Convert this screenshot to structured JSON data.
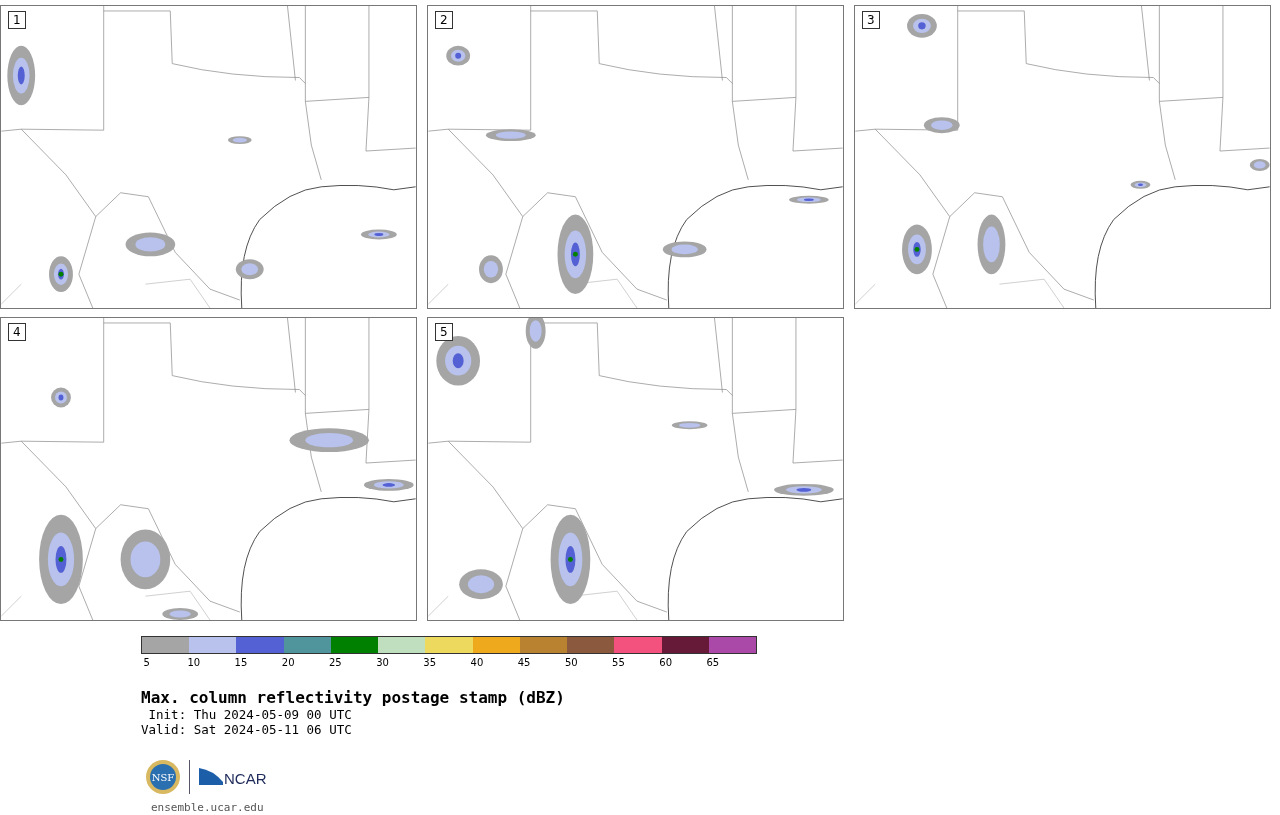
{
  "panels": [
    {
      "label": "1"
    },
    {
      "label": "2"
    },
    {
      "label": "3"
    },
    {
      "label": "4"
    },
    {
      "label": "5"
    }
  ],
  "colorbar": {
    "bins": [
      {
        "color": "#a5a5a5"
      },
      {
        "color": "#b8c2ec"
      },
      {
        "color": "#5461d4"
      },
      {
        "color": "#4f959b"
      },
      {
        "color": "#008000"
      },
      {
        "color": "#bfdfbf"
      },
      {
        "color": "#eed95f"
      },
      {
        "color": "#eeaa1c"
      },
      {
        "color": "#b88230"
      },
      {
        "color": "#8b5a3e"
      },
      {
        "color": "#f3527f"
      },
      {
        "color": "#661a38"
      },
      {
        "color": "#aa49a7"
      }
    ],
    "ticks": [
      "5",
      "10",
      "15",
      "20",
      "25",
      "30",
      "35",
      "40",
      "45",
      "50",
      "55",
      "60",
      "65"
    ]
  },
  "title": "Max. column reflectivity postage stamp (dBZ)",
  "init": " Init: Thu 2024-05-09 00 UTC",
  "valid": "Valid: Sat 2024-05-11 06 UTC",
  "logos": {
    "nsf": "NSF",
    "ncar": "NCAR"
  },
  "url": "ensemble.ucar.edu"
}
